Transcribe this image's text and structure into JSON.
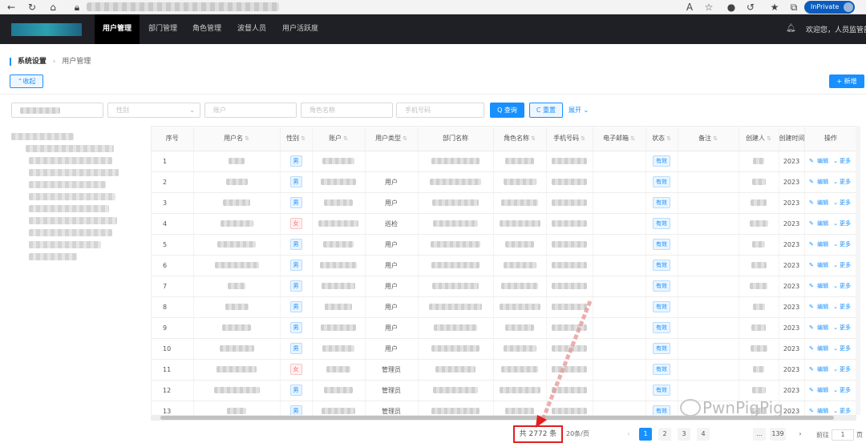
{
  "browser": {
    "inprivate_label": "InPrivate"
  },
  "nav": {
    "items": [
      "用户管理",
      "部门管理",
      "角色管理",
      "波督人员",
      "用户活跃度"
    ],
    "welcome": "欢迎您，人员监管部"
  },
  "breadcrumb": {
    "root": "系统设置",
    "current": "用户管理"
  },
  "toolbar": {
    "collapse_label": "⌃收起",
    "add_label": "+ 新增"
  },
  "filters": {
    "status_placeholder": "性别",
    "account_placeholder": "账户",
    "role_placeholder": "角色名称",
    "phone_placeholder": "手机号码",
    "query_label": "Q 查询",
    "reset_label": "C 重置",
    "expand_label": "展开 ⌄"
  },
  "table": {
    "columns": [
      "序号",
      "用户名",
      "性别",
      "账户",
      "用户类型",
      "部门名称",
      "角色名称",
      "手机号码",
      "电子邮箱",
      "状态",
      "备注",
      "创建人",
      "创建时间",
      "操作"
    ],
    "status_label": "有效",
    "edit_label": "编辑",
    "more_label": "更多",
    "rows": [
      {
        "seq": "1",
        "gender": "男",
        "gender_type": "m",
        "user_type": "",
        "year": "2023"
      },
      {
        "seq": "2",
        "gender": "男",
        "gender_type": "m",
        "user_type": "用户",
        "year": "2023"
      },
      {
        "seq": "3",
        "gender": "男",
        "gender_type": "m",
        "user_type": "用户",
        "year": "2023"
      },
      {
        "seq": "4",
        "gender": "女",
        "gender_type": "f",
        "user_type": "巡检",
        "year": "2023"
      },
      {
        "seq": "5",
        "gender": "男",
        "gender_type": "m",
        "user_type": "用户",
        "year": "2023"
      },
      {
        "seq": "6",
        "gender": "男",
        "gender_type": "m",
        "user_type": "用户",
        "year": "2023"
      },
      {
        "seq": "7",
        "gender": "男",
        "gender_type": "m",
        "user_type": "用户",
        "year": "2023"
      },
      {
        "seq": "8",
        "gender": "男",
        "gender_type": "m",
        "user_type": "用户",
        "year": "2023"
      },
      {
        "seq": "9",
        "gender": "男",
        "gender_type": "m",
        "user_type": "用户",
        "year": "2023"
      },
      {
        "seq": "10",
        "gender": "男",
        "gender_type": "m",
        "user_type": "用户",
        "year": "2023"
      },
      {
        "seq": "11",
        "gender": "女",
        "gender_type": "f",
        "user_type": "管理员",
        "year": "2023"
      },
      {
        "seq": "12",
        "gender": "男",
        "gender_type": "m",
        "user_type": "管理员",
        "year": "2023"
      },
      {
        "seq": "13",
        "gender": "男",
        "gender_type": "m",
        "user_type": "管理员",
        "year": "2023"
      }
    ]
  },
  "pagination": {
    "total": "共 2772 条",
    "page_size": "20条/页",
    "pages": [
      "1",
      "2",
      "3",
      "4",
      "...",
      "139"
    ],
    "current_page": "1",
    "goto_label": "前往",
    "goto_value": "1",
    "page_suffix": "页"
  },
  "watermark": "PwnPigPig",
  "colors": {
    "accent": "#1890ff",
    "nav_bg": "#1f2025",
    "highlight_red": "#e02020"
  }
}
